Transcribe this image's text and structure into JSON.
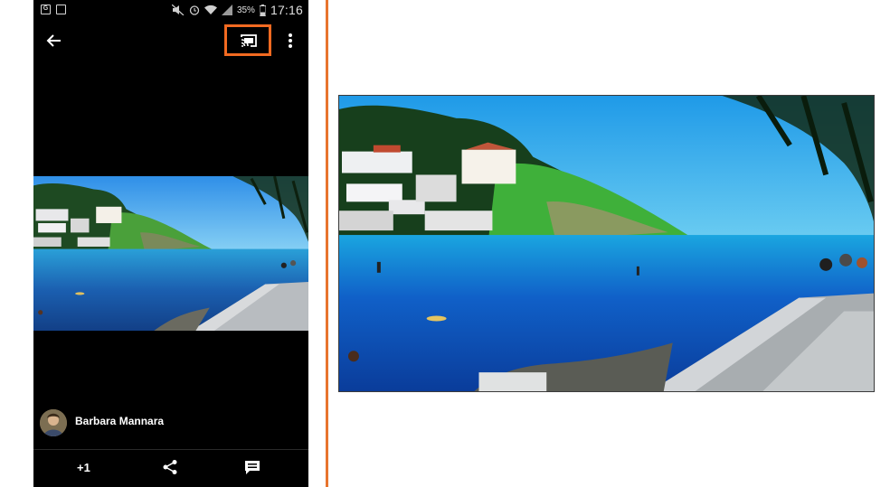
{
  "status_bar": {
    "left_icons": [
      "G",
      "gallery-icon"
    ],
    "battery_percent": "35%",
    "time": "17:16"
  },
  "toolbar": {
    "back_icon": "arrow-back-icon",
    "cast_icon": "cast-icon",
    "more_icon": "more-vert-icon",
    "cast_highlight_color": "#f26a21"
  },
  "photo": {
    "author": "Barbara Mannara"
  },
  "actions": {
    "plus_one_label": "+1",
    "share_icon": "share-icon",
    "comment_icon": "comment-icon"
  },
  "divider_color": "#e8742e"
}
